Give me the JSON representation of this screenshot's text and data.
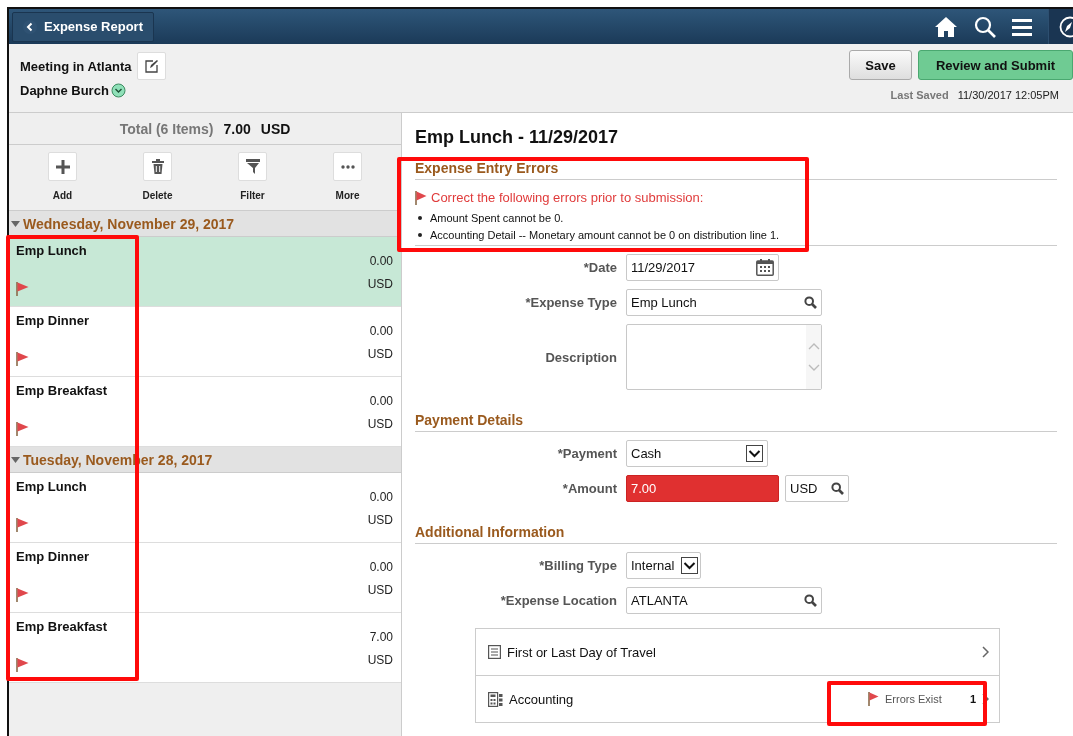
{
  "header": {
    "back_label": "Expense Report"
  },
  "report": {
    "title": "Meeting in Atlanta",
    "employee": "Daphne Burch"
  },
  "actions": [
    {
      "label": "Save",
      "kind": "secondary"
    },
    {
      "label": "Review and Submit",
      "kind": "primary"
    }
  ],
  "last_saved": {
    "label": "Last Saved",
    "value": "11/30/2017 12:05PM"
  },
  "totals": {
    "label": "Total (6 Items)",
    "amount": "7.00",
    "currency": "USD"
  },
  "toolbar": [
    {
      "label": "Add",
      "kind": "plus"
    },
    {
      "label": "Delete",
      "kind": "trash"
    },
    {
      "label": "Filter",
      "kind": "funnel"
    },
    {
      "label": "More",
      "kind": "dots"
    }
  ],
  "groups": [
    {
      "date": "Wednesday, November 29, 2017",
      "expanded": true,
      "items": [
        {
          "name": "Emp Lunch",
          "amount": "0.00",
          "currency": "USD",
          "selected": true,
          "flagged": true
        },
        {
          "name": "Emp Dinner",
          "amount": "0.00",
          "currency": "USD",
          "selected": false,
          "flagged": true
        },
        {
          "name": "Emp Breakfast",
          "amount": "0.00",
          "currency": "USD",
          "selected": false,
          "flagged": true
        }
      ]
    },
    {
      "date": "Tuesday, November 28, 2017",
      "expanded": true,
      "items": [
        {
          "name": "Emp Lunch",
          "amount": "0.00",
          "currency": "USD",
          "selected": false,
          "flagged": true
        },
        {
          "name": "Emp Dinner",
          "amount": "0.00",
          "currency": "USD",
          "selected": false,
          "flagged": true
        },
        {
          "name": "Emp Breakfast",
          "amount": "7.00",
          "currency": "USD",
          "selected": false,
          "flagged": true
        }
      ]
    }
  ],
  "detail": {
    "title": "Emp Lunch - 11/29/2017",
    "errors": {
      "heading": "Expense Entry Errors",
      "message": "Correct the following errors prior to submission:",
      "items": [
        "Amount Spent cannot be 0.",
        "Accounting Detail -- Monetary amount cannot be 0 on distribution line 1."
      ]
    },
    "fields": [
      {
        "label": "*Date",
        "kind": "date",
        "value": "11/29/2017"
      },
      {
        "label": "*Expense Type",
        "kind": "lookup",
        "value": "Emp Lunch"
      },
      {
        "label": "Description",
        "kind": "textarea"
      }
    ],
    "sections": [
      {
        "heading": "Payment Details",
        "fields": [
          {
            "label": "*Payment",
            "kind": "select",
            "value": "Cash"
          },
          {
            "label": "*Amount",
            "kind": "amount",
            "value": "7.00",
            "error": true,
            "currency": "USD"
          }
        ]
      },
      {
        "heading": "Additional Information",
        "fields": [
          {
            "label": "*Billing Type",
            "kind": "select-small",
            "value": "Internal"
          },
          {
            "label": "*Expense Location",
            "kind": "lookup",
            "value": "ATLANTA"
          }
        ]
      }
    ],
    "links": [
      {
        "label": "First or Last Day of Travel",
        "kind": "list"
      },
      {
        "label": "Accounting",
        "kind": "calculator",
        "status": "Errors Exist",
        "count": "1"
      }
    ]
  }
}
